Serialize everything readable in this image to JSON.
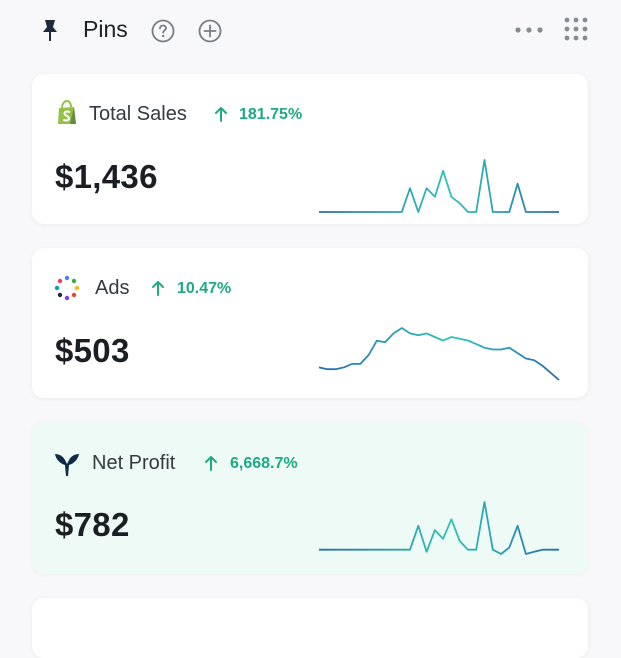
{
  "header": {
    "title": "Pins",
    "icons": [
      "pin-icon",
      "help-icon",
      "add-icon",
      "more-icon",
      "grid-icon"
    ]
  },
  "colors": {
    "accent_green": "#1fa985",
    "sparkline_start": "#2b6cb0",
    "sparkline_end": "#2ec4b6",
    "highlight_bg": "#eefaf5"
  },
  "cards": [
    {
      "label": "Total Sales",
      "change": "181.75%",
      "value": "$1,436",
      "icon": "shopify-icon",
      "trend": [
        0,
        0,
        0,
        0,
        0,
        0,
        0,
        0,
        0,
        0,
        0,
        22,
        0,
        22,
        14,
        38,
        14,
        8,
        0,
        0,
        48,
        0,
        0,
        0,
        26,
        0,
        0,
        0,
        0,
        0
      ]
    },
    {
      "label": "Ads",
      "change": "10.47%",
      "value": "$503",
      "icon": "ads-dots-icon",
      "trend": [
        14,
        12,
        12,
        14,
        18,
        18,
        28,
        44,
        42,
        52,
        58,
        52,
        50,
        52,
        48,
        44,
        48,
        46,
        44,
        40,
        36,
        34,
        34,
        36,
        30,
        24,
        22,
        16,
        8,
        0
      ]
    },
    {
      "label": "Net Profit",
      "change": "6,668.7%",
      "value": "$782",
      "icon": "triple-whale-icon",
      "trend": [
        4,
        4,
        4,
        4,
        4,
        4,
        4,
        4,
        4,
        4,
        4,
        4,
        26,
        2,
        22,
        14,
        32,
        12,
        4,
        4,
        48,
        4,
        0,
        6,
        26,
        0,
        2,
        4,
        4,
        4
      ]
    }
  ]
}
